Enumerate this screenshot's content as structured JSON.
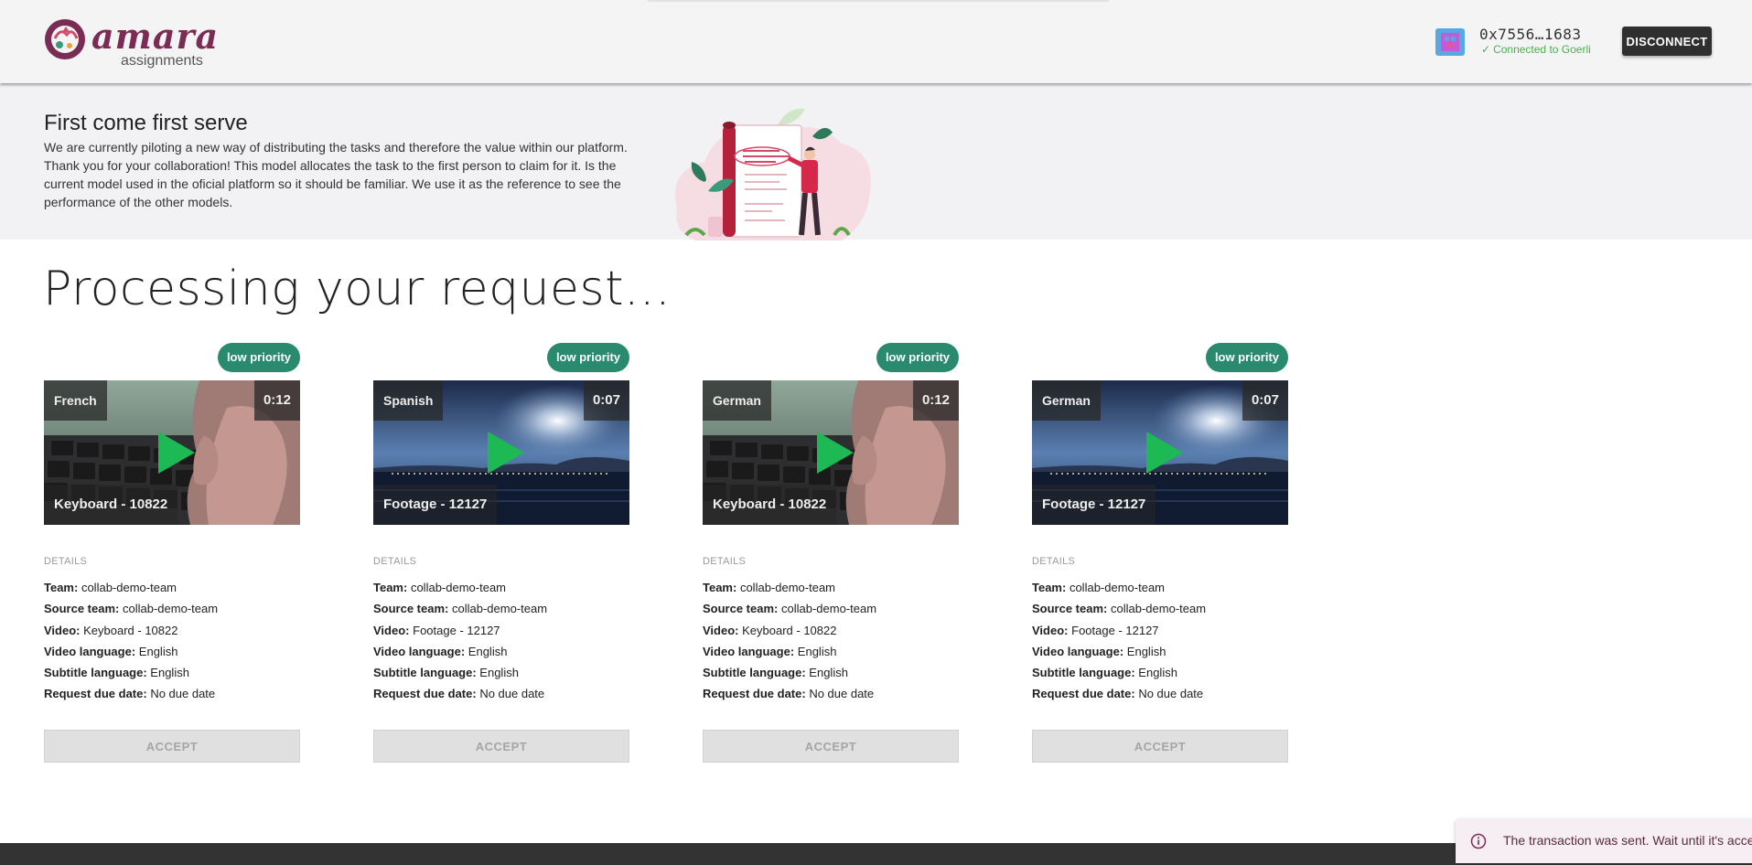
{
  "header": {
    "logo_word": "amara",
    "logo_subtitle": "assignments",
    "wallet_address": "0x7556…1683",
    "wallet_status": "Connected to Goerli",
    "disconnect_label": "DISCONNECT"
  },
  "banner": {
    "title": "First come first serve",
    "text": "We are currently piloting a new way of distributing the tasks and therefore the value within our platform. Thank you for your collaboration! This model allocates the task to the first person to claim for it. Is the current model used in the oficial platform so it should be familiar. We use it as the reference to see the performance of the other models."
  },
  "main": {
    "heading": "Processing your request..."
  },
  "labels": {
    "details": "DETAILS",
    "team": "Team:",
    "source_team": "Source team:",
    "video": "Video:",
    "video_language": "Video language:",
    "subtitle_language": "Subtitle language:",
    "request_due_date": "Request due date:",
    "accept": "ACCEPT"
  },
  "cards": [
    {
      "priority": "low priority",
      "language": "French",
      "duration": "0:12",
      "video_title": "Keyboard - 10822",
      "thumbnail": "keyboard",
      "team": "collab-demo-team",
      "source_team": "collab-demo-team",
      "video": "Keyboard - 10822",
      "video_language": "English",
      "subtitle_language": "English",
      "due_date": "No due date"
    },
    {
      "priority": "low priority",
      "language": "Spanish",
      "duration": "0:07",
      "video_title": "Footage - 12127",
      "thumbnail": "night-lake",
      "team": "collab-demo-team",
      "source_team": "collab-demo-team",
      "video": "Footage - 12127",
      "video_language": "English",
      "subtitle_language": "English",
      "due_date": "No due date"
    },
    {
      "priority": "low priority",
      "language": "German",
      "duration": "0:12",
      "video_title": "Keyboard - 10822",
      "thumbnail": "keyboard",
      "team": "collab-demo-team",
      "source_team": "collab-demo-team",
      "video": "Keyboard - 10822",
      "video_language": "English",
      "subtitle_language": "English",
      "due_date": "No due date"
    },
    {
      "priority": "low priority",
      "language": "German",
      "duration": "0:07",
      "video_title": "Footage - 12127",
      "thumbnail": "night-lake",
      "team": "collab-demo-team",
      "source_team": "collab-demo-team",
      "video": "Footage - 12127",
      "video_language": "English",
      "subtitle_language": "English",
      "due_date": "No due date"
    }
  ],
  "toast": {
    "icon": "info-icon",
    "message": "The transaction was sent. Wait until it's acce"
  },
  "colors": {
    "brand": "#7a2c54",
    "priority_badge": "#2a8a6e",
    "play_icon": "#1db954",
    "connected": "#4caf50",
    "footer": "#333333"
  }
}
